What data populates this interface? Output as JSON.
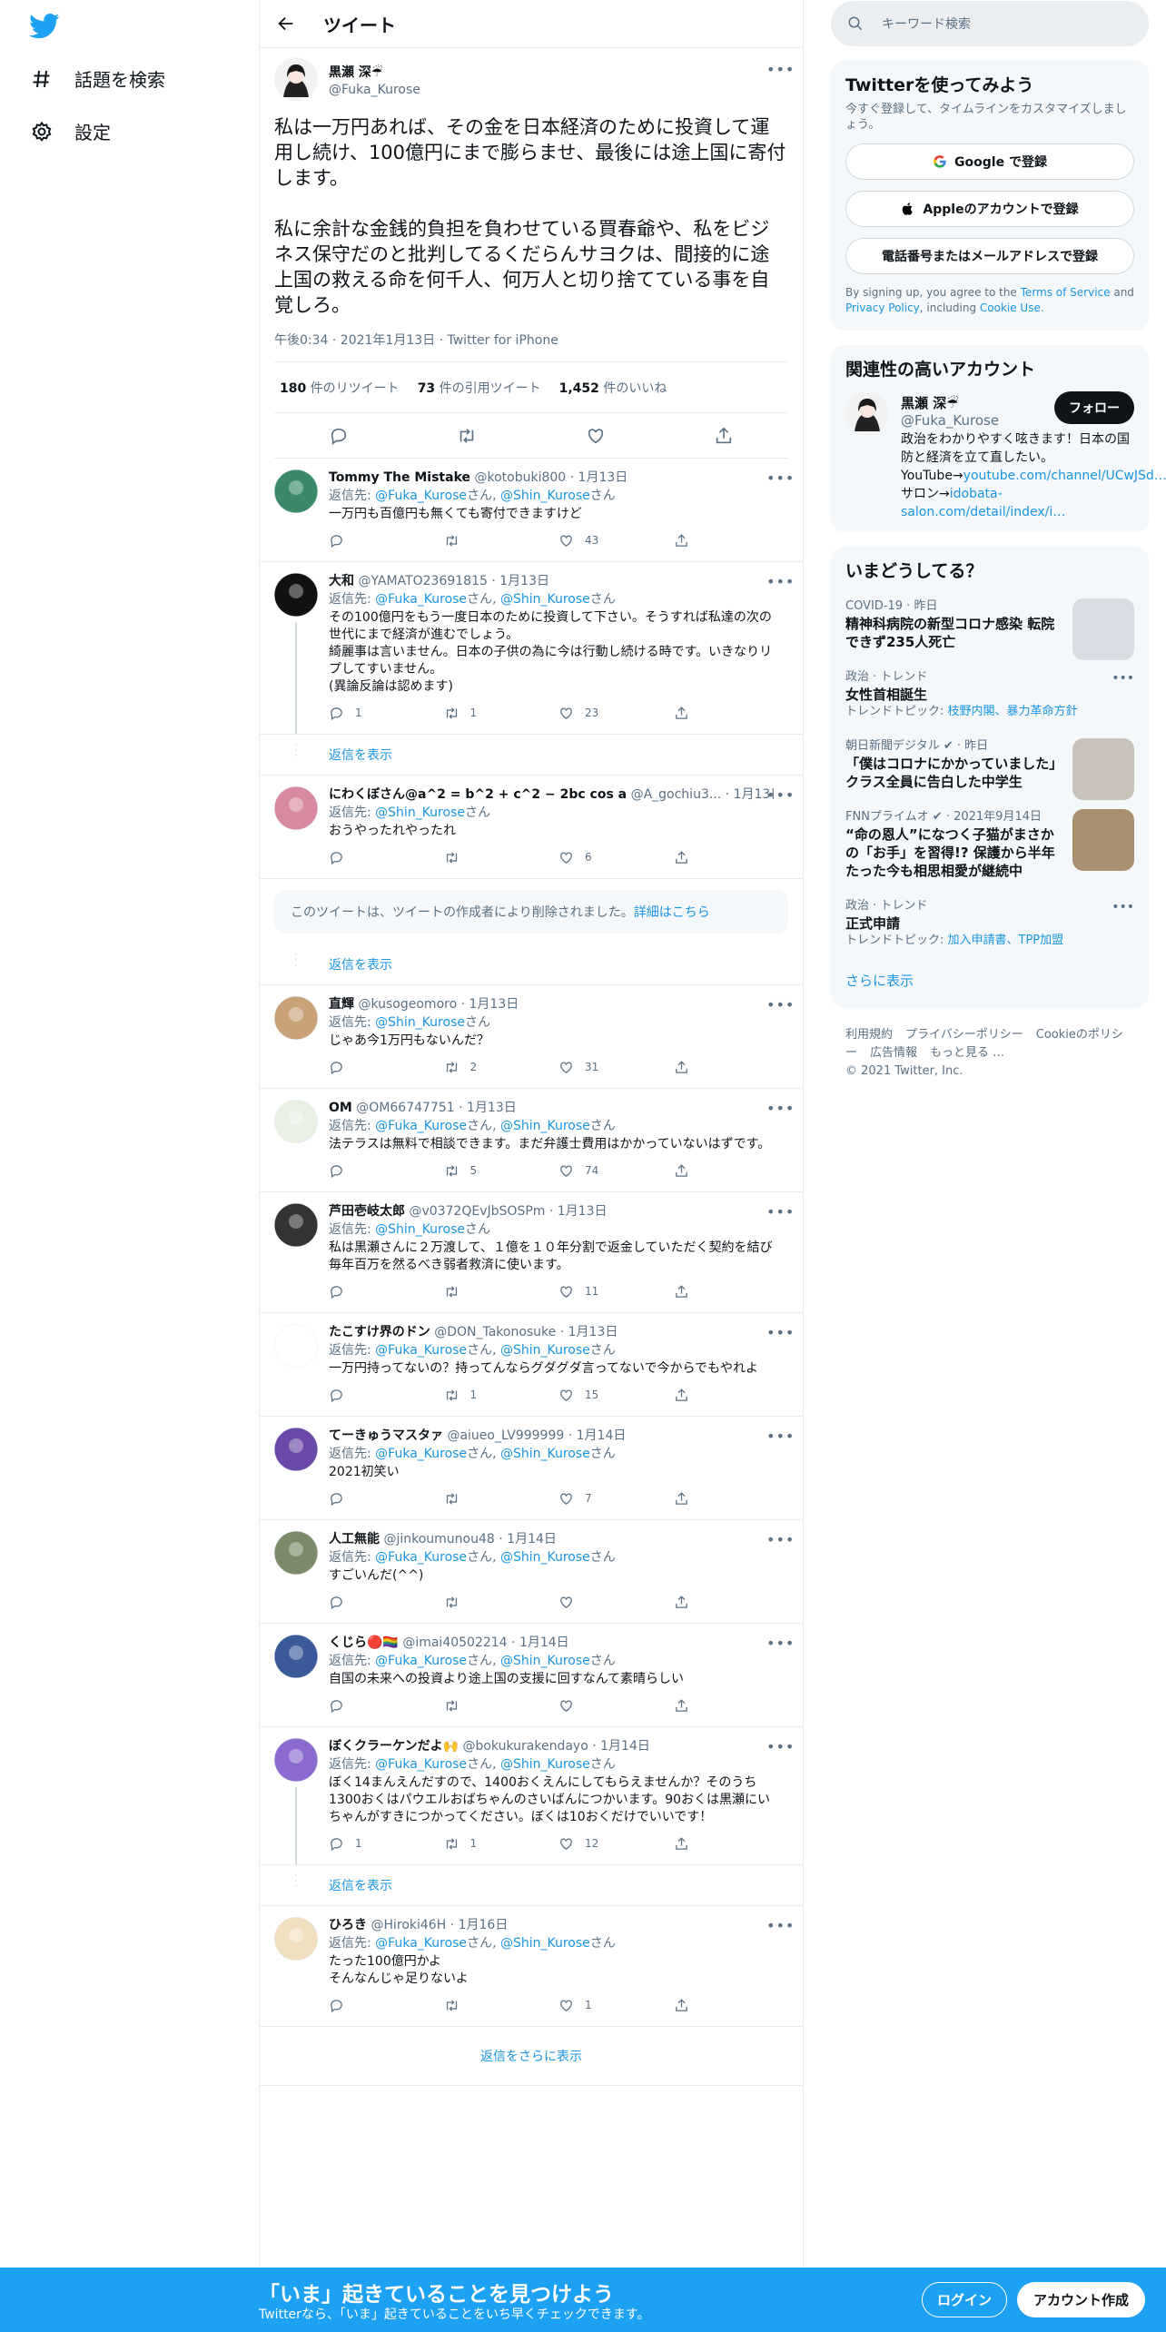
{
  "nav": {
    "explore": "話題を検索",
    "settings": "設定"
  },
  "header": {
    "title": "ツイート"
  },
  "main_tweet": {
    "name": "黒瀬 深☔",
    "handle": "@Fuka_Kurose",
    "text": "私は一万円あれば、その金を日本経済のために投資して運用し続け、100億円にまで膨らませ、最後には途上国に寄付します。\n\n私に余計な金銭的負担を負わせている買春爺や、私をビジネス保守だのと批判してるくだらんサヨクは、間接的に途上国の救える命を何千人、何万人と切り捨てている事を自覚しろ。",
    "meta": "午後0:34 · 2021年1月13日 · Twitter for iPhone",
    "retweets": "180",
    "retweets_label": " 件のリツイート",
    "quotes": "73",
    "quotes_label": " 件の引用ツイート",
    "likes": "1,452",
    "likes_label": " 件のいいね"
  },
  "labels": {
    "reply_to": "返信先: ",
    "san": "さん",
    "show_replies": "返信を表示",
    "deleted": "このツイートは、ツイートの作成者により削除されました。",
    "deleted_link": "詳細はこちら",
    "more_replies": "返信をさらに表示"
  },
  "replies": [
    {
      "name": "Tommy The Mistake",
      "handle": "@kotobuki800",
      "date": "1月13日",
      "to": [
        "@Fuka_Kurose",
        "@Shin_Kurose"
      ],
      "text": "一万円も百億円も無くても寄付できますけど",
      "reply": "",
      "rt": "",
      "like": "43",
      "avatar_color": "#3a8a6a"
    },
    {
      "name": "大和",
      "handle": "@YAMATO23691815",
      "date": "1月13日",
      "to": [
        "@Fuka_Kurose",
        "@Shin_Kurose"
      ],
      "text": "その100億円をもう一度日本のために投資して下さい。そうすれば私達の次の世代にまで経済が進むでしょう。\n綺麗事は言いません。日本の子供の為に今は行動し続ける時です。いきなりリプしてすいません。\n(異論反論は認めます)",
      "reply": "1",
      "rt": "1",
      "like": "23",
      "avatar_color": "#111111"
    },
    {
      "name": "にわくぼさん@a^2 = b^2 + c^2 − 2bc cos a",
      "handle": "@A_gochiu3...",
      "date": "1月13日",
      "to": [
        "@Shin_Kurose"
      ],
      "text": "おうやったれやったれ",
      "reply": "",
      "rt": "",
      "like": "6",
      "avatar_color": "#d98aa0"
    },
    {
      "name": "直輝",
      "handle": "@kusogeomoro",
      "date": "1月13日",
      "to": [
        "@Shin_Kurose"
      ],
      "text": "じゃあ今1万円もないんだ？",
      "reply": "",
      "rt": "2",
      "like": "31",
      "avatar_color": "#c9a27a"
    },
    {
      "name": "OM",
      "handle": "@OM66747751",
      "date": "1月13日",
      "to": [
        "@Fuka_Kurose",
        "@Shin_Kurose"
      ],
      "text": "法テラスは無料で相談できます。まだ弁護士費用はかかっていないはずです。",
      "reply": "",
      "rt": "5",
      "like": "74",
      "avatar_color": "#e8f0e4"
    },
    {
      "name": "芦田壱岐太郎",
      "handle": "@v0372QEvJbSOSPm",
      "date": "1月13日",
      "to": [
        "@Shin_Kurose"
      ],
      "text": "私は黒瀬さんに２万渡して、１億を１０年分割で返金していただく契約を結び毎年百万を然るべき弱者救済に使います。",
      "reply": "",
      "rt": "",
      "like": "11",
      "avatar_color": "#333333"
    },
    {
      "name": "たこすけ界のドン",
      "handle": "@DON_Takonosuke",
      "date": "1月13日",
      "to": [
        "@Fuka_Kurose",
        "@Shin_Kurose"
      ],
      "text": "一万円持ってないの？持ってんならグダグダ言ってないで今からでもやれよ",
      "reply": "",
      "rt": "1",
      "like": "15",
      "avatar_color": "#ffffff"
    },
    {
      "name": "てーきゅうマスタァ",
      "handle": "@aiueo_LV999999",
      "date": "1月14日",
      "to": [
        "@Fuka_Kurose",
        "@Shin_Kurose"
      ],
      "text": "2021初笑い",
      "reply": "",
      "rt": "",
      "like": "7",
      "avatar_color": "#6a4aa8"
    },
    {
      "name": "人工無能",
      "handle": "@jinkoumunou48",
      "date": "1月14日",
      "to": [
        "@Fuka_Kurose",
        "@Shin_Kurose"
      ],
      "text": "すごいんだ(^^)",
      "reply": "",
      "rt": "",
      "like": "",
      "avatar_color": "#7a8a6a"
    },
    {
      "name": "くじら🔴🏳️‍🌈",
      "handle": "@imai40502214",
      "date": "1月14日",
      "to": [
        "@Fuka_Kurose",
        "@Shin_Kurose"
      ],
      "text": "自国の未来への投資より途上国の支援に回すなんて素晴らしい",
      "reply": "",
      "rt": "",
      "like": "",
      "avatar_color": "#3a5a9a"
    },
    {
      "name": "ぼくクラーケンだよ🙌",
      "handle": "@bokukurakendayo",
      "date": "1月14日",
      "to": [
        "@Fuka_Kurose",
        "@Shin_Kurose"
      ],
      "text": "ぼく14まんえんだすので、1400おくえんにしてもらえませんか？そのうち1300おくはパウエルおばちゃんのさいばんにつかいます。90おくは黒瀬にいちゃんがすきにつかってください。ぼくは10おくだけでいいです！",
      "reply": "1",
      "rt": "1",
      "like": "12",
      "avatar_color": "#8a6ad0"
    },
    {
      "name": "ひろき",
      "handle": "@Hiroki46H",
      "date": "1月16日",
      "to": [
        "@Fuka_Kurose",
        "@Shin_Kurose"
      ],
      "text": "たった100億円かよ\nそんなんじゃ足りないよ",
      "reply": "",
      "rt": "",
      "like": "1",
      "avatar_color": "#f0e0c0"
    }
  ],
  "search": {
    "placeholder": "キーワード検索"
  },
  "signup": {
    "title": "Twitterを使ってみよう",
    "subtitle": "今すぐ登録して、タイムラインをカスタマイズしましょう。",
    "google": "Google で登録",
    "apple": "Appleのアカウントで登録",
    "phone": "電話番号またはメールアドレスで登録",
    "terms_pre": "By signing up, you agree to the ",
    "terms_tos": "Terms of Service",
    "terms_and": " and ",
    "terms_privacy": "Privacy Policy",
    "terms_incl": ", including ",
    "terms_cookie": "Cookie Use",
    "terms_end": "."
  },
  "relevant": {
    "title": "関連性の高いアカウント",
    "name": "黒瀬 深☔",
    "handle": "@Fuka_Kurose",
    "follow": "フォロー",
    "bio_pre": "政治をわかりやすく呟きます！日本の国防と経済を立て直したい。YouTube→",
    "bio_link1": "youtube.com/channel/UCwJSd…",
    "bio_mid": " サロン→",
    "bio_link2": "idobata-salon.com/detail/index/i…"
  },
  "trends": {
    "title": "いまどうしてる？",
    "items": [
      {
        "cat": "COVID-19 · 昨日",
        "title": "精神科病院の新型コロナ感染 転院できず235人死亡",
        "sub": "",
        "img_color": "#d8dde3"
      },
      {
        "cat": "政治 · トレンド",
        "title": "女性首相誕生",
        "sub": "トレンドトピック: ",
        "sub_links": "枝野内閣、暴力革命方針",
        "img_color": ""
      },
      {
        "cat": "朝日新聞デジタル ✔ · 昨日",
        "title": "「僕はコロナにかかっていました」クラス全員に告白した中学生",
        "sub": "",
        "img_color": "#c9c2b8"
      },
      {
        "cat": "FNNプライムオ ✔ · 2021年9月14日",
        "title": "“命の恩人”になつく子猫がまさかの「お手」を習得!? 保護から半年たった今も相思相愛が継続中",
        "sub": "",
        "img_color": "#a89070"
      },
      {
        "cat": "政治 · トレンド",
        "title": "正式申請",
        "sub": "トレンドトピック: ",
        "sub_links": "加入申請書、TPP加盟",
        "img_color": ""
      }
    ],
    "show_more": "さらに表示"
  },
  "footer": {
    "links": [
      "利用規約",
      "プライバシーポリシー",
      "Cookieのポリシー",
      "広告情報",
      "もっと見る …"
    ],
    "copyright": "© 2021 Twitter, Inc."
  },
  "bottom_bar": {
    "title": "「いま」起きていることを見つけよう",
    "subtitle": "Twitterなら、「いま」起きていることをいち早くチェックできます。",
    "login": "ログイン",
    "signup": "アカウント作成"
  },
  "colors": {
    "accent": "#1da1f2",
    "link": "#1b95e0"
  }
}
